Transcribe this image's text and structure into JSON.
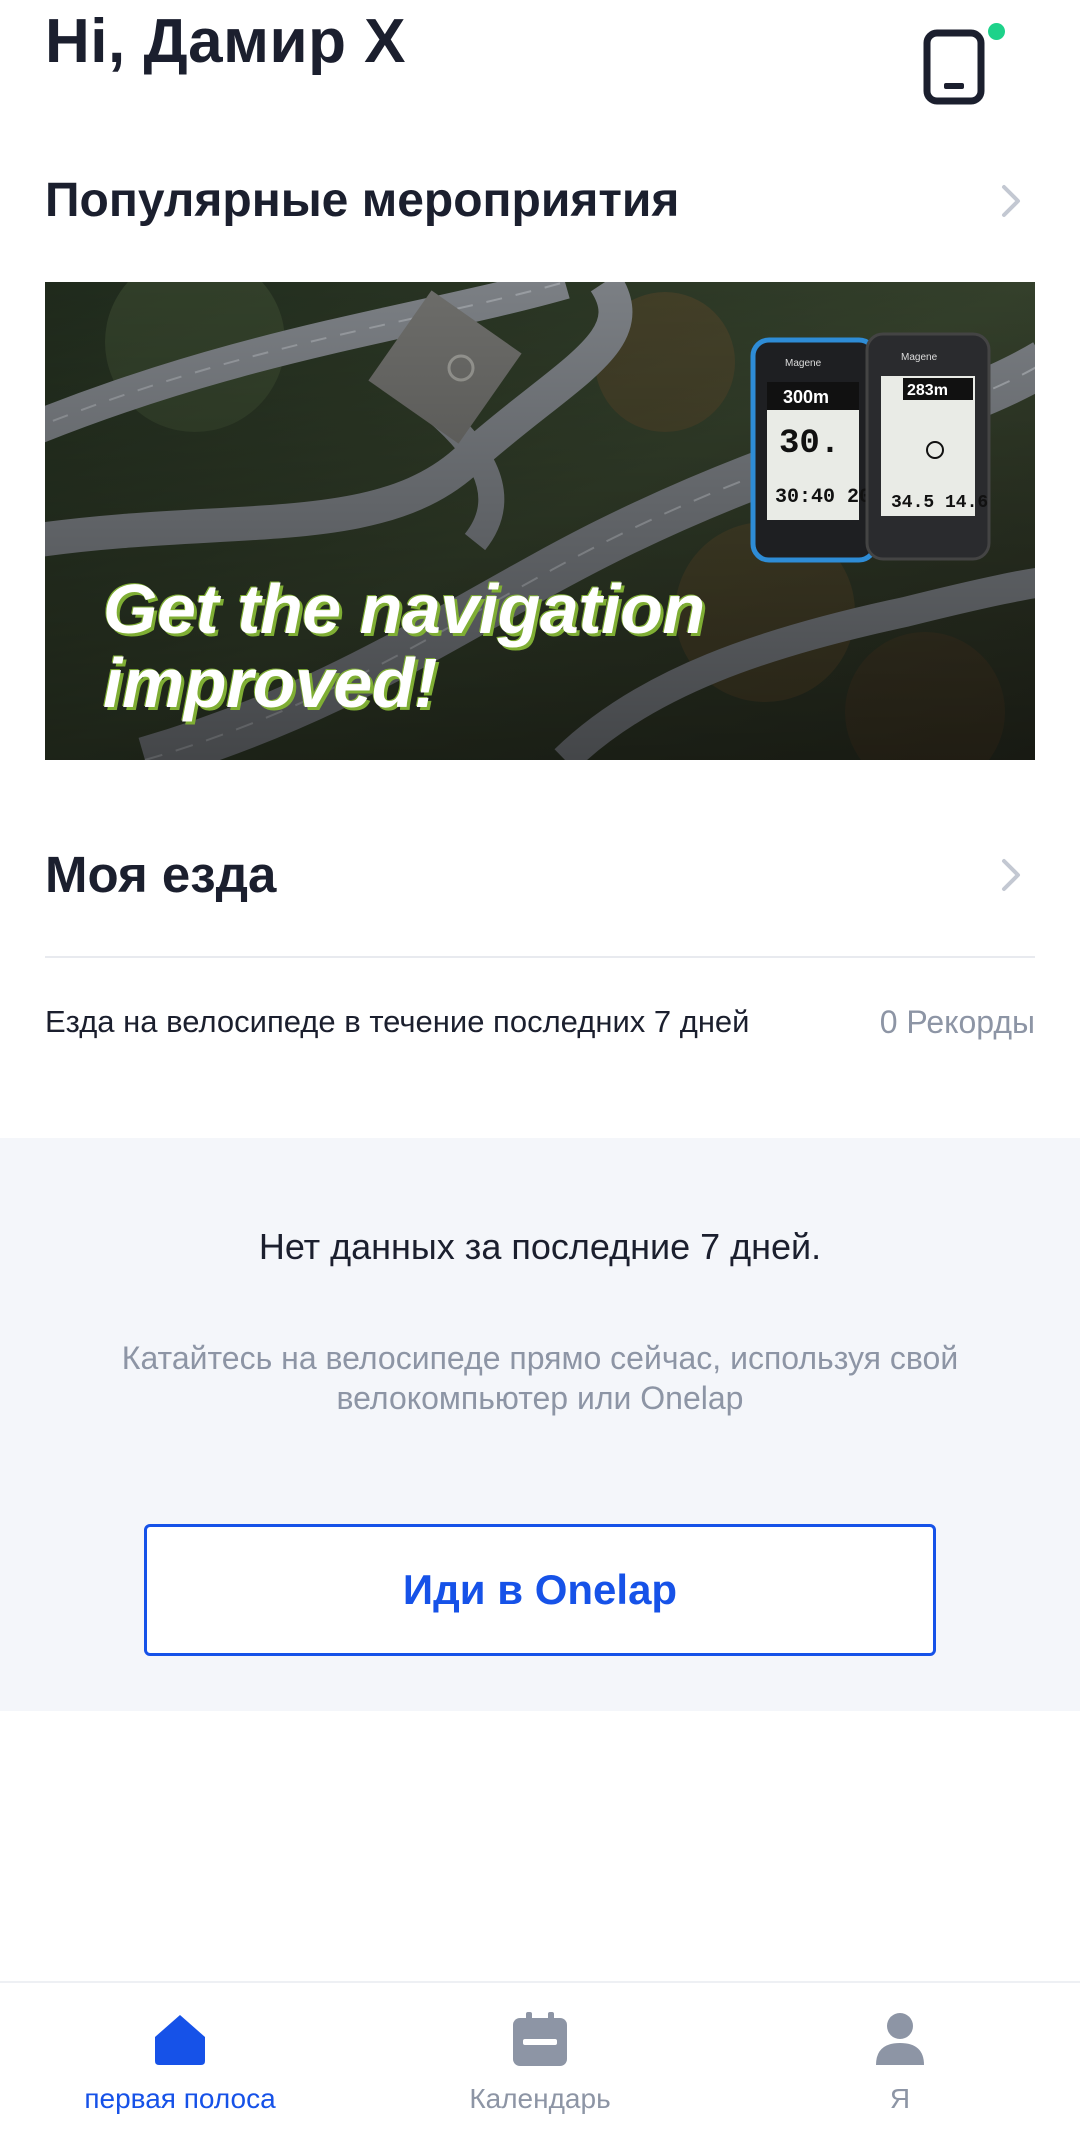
{
  "header": {
    "greeting": "Hi, Дамир X",
    "device_icon": "phone-device-icon",
    "status_color": "#1ed28a"
  },
  "events": {
    "title": "Популярные мероприятия",
    "banner": {
      "text_line1": "Get the navigation",
      "text_line2": "improved!"
    }
  },
  "ride": {
    "title": "Моя езда",
    "description": "Езда на велосипеде в течение последних 7 дней",
    "records": "0 Рекорды"
  },
  "empty_state": {
    "title": "Нет данных за последние 7 дней.",
    "subtitle": "Катайтесь на велосипеде прямо сейчас, используя свой велокомпьютер или Onelap",
    "button_label": "Иди в Onelap"
  },
  "tabbar": {
    "active_color": "#1652e8",
    "inactive_color": "#8d95a5",
    "tabs": [
      {
        "label": "первая полоса",
        "icon": "home-icon",
        "active": true
      },
      {
        "label": "Календарь",
        "icon": "calendar-icon",
        "active": false
      },
      {
        "label": "Я",
        "icon": "person-icon",
        "active": false
      }
    ]
  }
}
